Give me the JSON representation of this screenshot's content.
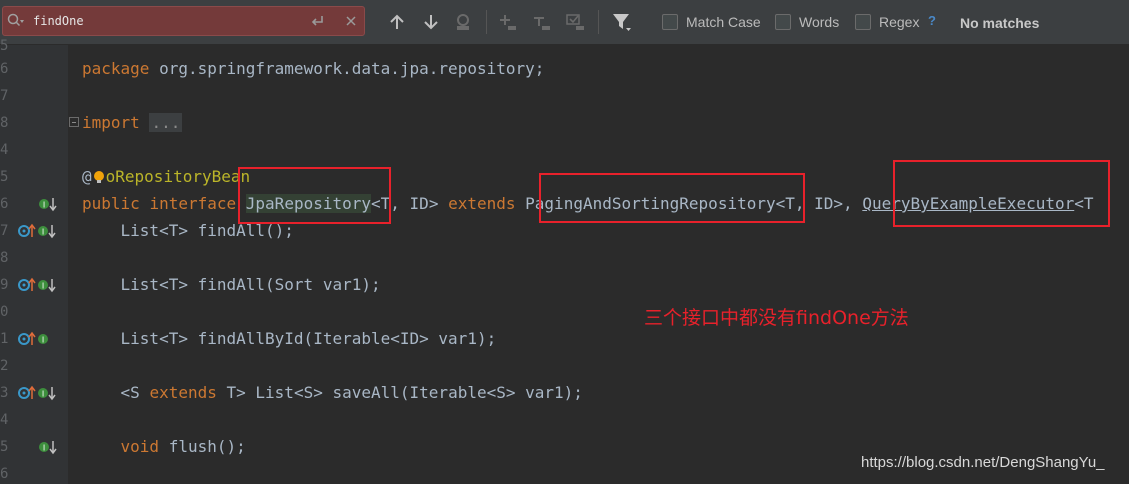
{
  "search": {
    "query": "findOne",
    "match_case_label": "Match Case",
    "words_label": "Words",
    "regex_label": "Regex",
    "help_label": "?",
    "status": "No matches"
  },
  "icons": [
    "search-icon",
    "history-icon",
    "clear-icon",
    "arrow-up-icon",
    "arrow-down-icon",
    "find-all-icon",
    "add-occurrence-icon",
    "remove-occurrence-icon",
    "select-all-occurrences-icon",
    "filter-icon"
  ],
  "editor": {
    "line_numbers": [
      "5",
      "6",
      "7",
      "8",
      "4",
      "5",
      "6",
      "7",
      "8",
      "9",
      "0",
      "1",
      "2",
      "3",
      "4",
      "5",
      "6"
    ],
    "lines": {
      "package": {
        "kw": "package",
        "rest": " org.springframework.data.jpa.repository;"
      },
      "import": {
        "kw": "import",
        "folded": "..."
      },
      "annotation": {
        "at": "@",
        "name": "oRepositoryBean"
      },
      "declaration": {
        "kw1": "public",
        "kw2": "interface",
        "name": "JpaRepository",
        "generic1": "<T, ID> ",
        "extends": "extends",
        "parent1": "PagingAndSortingRepository",
        "generic2": "<T, ID>, ",
        "parent2": "QueryByExampleExecutor",
        "generic3": "<T"
      },
      "m1": "    List<T> findAll();",
      "m2": "    List<T> findAll(Sort var1);",
      "m3": "    List<T> findAllById(Iterable<ID> var1);",
      "m4": {
        "pre": "    <S ",
        "kw": "extends",
        "post": " T> List<S> saveAll(Iterable<S> var1);"
      },
      "m5": {
        "pre": "    ",
        "kw": "void",
        "post": " flush();"
      }
    }
  },
  "annotation_note": "三个接口中都没有findOne方法",
  "watermark": "https://blog.csdn.net/DengShangYu_",
  "colors": {
    "keyword": "#cc7832",
    "text": "#a9b7c6",
    "annotation_red": "#e8212b",
    "background": "#2b2b2b",
    "search_error": "#743a3a"
  }
}
